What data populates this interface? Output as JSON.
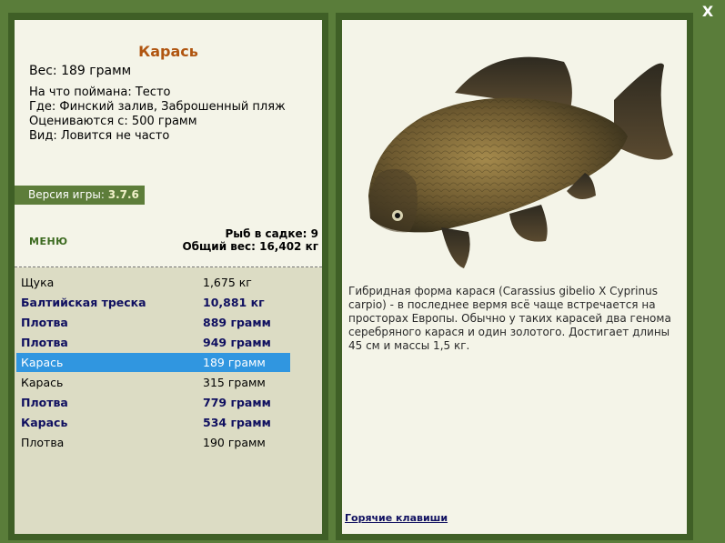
{
  "fish": {
    "name": "Карась",
    "weight_label": "Вес: 189 грамм",
    "caught_on": "На что поймана: Тесто",
    "location": "Где: Финский залив, Заброшенный пляж",
    "valued_from": "Оцениваются с: 500 грамм",
    "rarity": "Вид: Ловится не часто"
  },
  "version": {
    "label": "Версия игры:",
    "number": "3.7.6"
  },
  "menu_label": "МЕНЮ",
  "keepnet": {
    "count_label": "Рыб в садке: 9",
    "total_label": "Общий вес: 16,402 кг"
  },
  "catch_list": [
    {
      "name": "Щука",
      "weight": "1,675 кг",
      "style": "normal"
    },
    {
      "name": "Балтийская треска",
      "weight": "10,881 кг",
      "style": "bold"
    },
    {
      "name": "Плотва",
      "weight": "889 грамм",
      "style": "bold"
    },
    {
      "name": "Плотва",
      "weight": "949 грамм",
      "style": "bold"
    },
    {
      "name": "Карась",
      "weight": "189 грамм",
      "style": "selected"
    },
    {
      "name": "Карась",
      "weight": "315 грамм",
      "style": "normal"
    },
    {
      "name": "Плотва",
      "weight": "779 грамм",
      "style": "bold"
    },
    {
      "name": "Карась",
      "weight": "534 грамм",
      "style": "bold"
    },
    {
      "name": "Плотва",
      "weight": "190 грамм",
      "style": "normal"
    }
  ],
  "description": "Гибридная форма карася (Carassius gibelio X Cyprinus carpio) - в последнее вермя всё чаще встречается на просторах Европы. Обычно у таких карасей два генома серебряного карася и один золотого. Достигает длины 45 см и массы 1,5 кг.",
  "hotkeys_label": "Горячие клавиши",
  "close_label": "X",
  "icons": {
    "close": "close-icon"
  },
  "colors": {
    "background": "#5a7d3a",
    "panel": "#f4f4e8",
    "title": "#b05510",
    "selected_row": "#3096e0",
    "bold_row": "#101060"
  }
}
